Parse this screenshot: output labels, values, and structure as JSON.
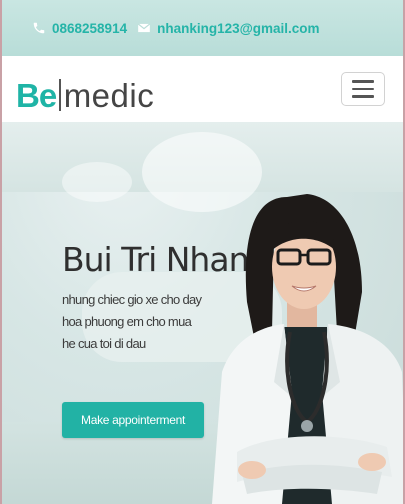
{
  "topbar": {
    "phone": "0868258914",
    "email": "nhanking123@gmail.com",
    "phone_icon": "phone-icon",
    "email_icon": "envelope-icon"
  },
  "navbar": {
    "logo_accent": "Be",
    "logo_rest": "medic",
    "menu_icon": "hamburger-icon"
  },
  "hero": {
    "title": "Bui Tri Nhan",
    "subtitle": "nhung chiec gio xe cho day hoa phuong em cho mua he cua toi di dau",
    "cta_label": "Make appointerment"
  },
  "colors": {
    "accent": "#22b2a5",
    "topbar_bg": "#c1e2dd",
    "text_dark": "#2f2f2f"
  }
}
